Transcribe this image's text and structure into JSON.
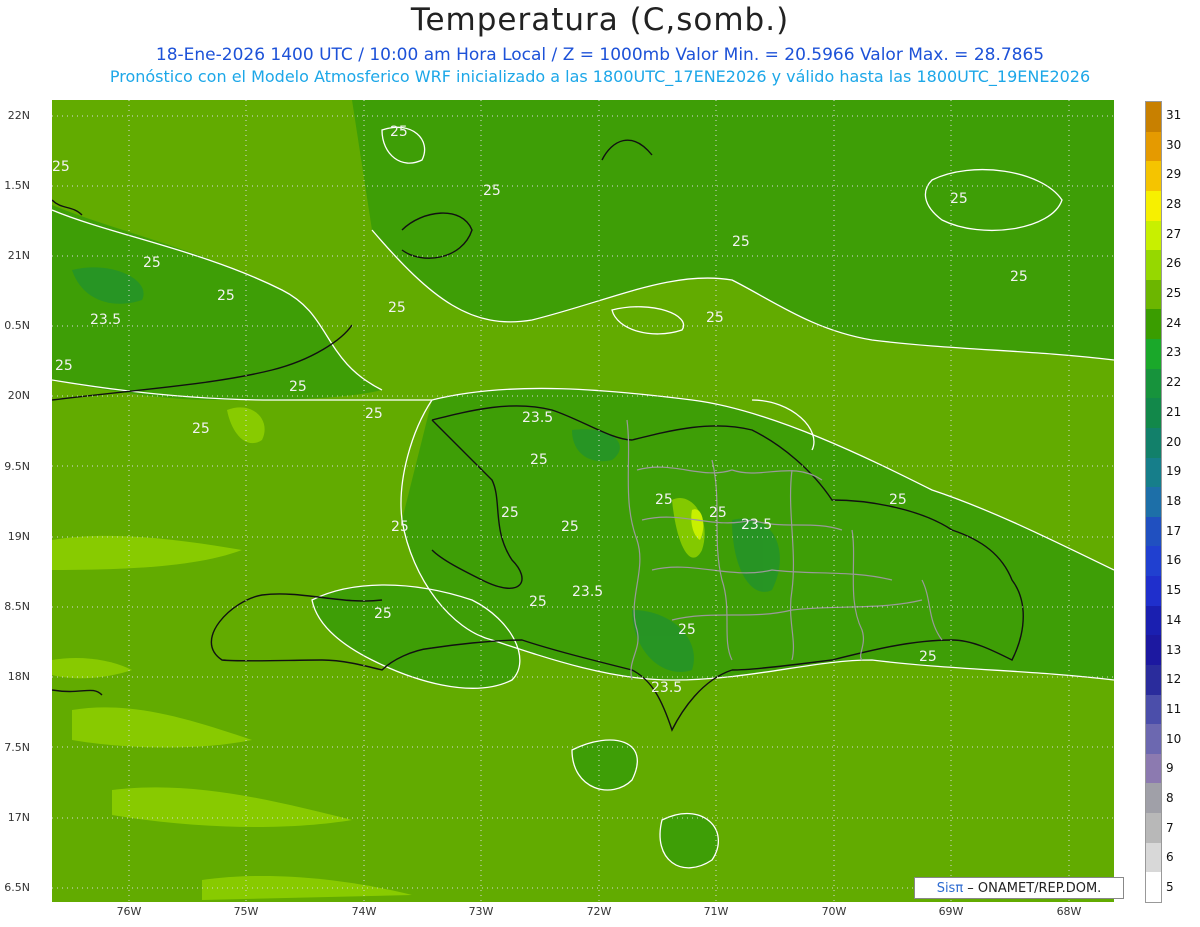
{
  "title": "Temperatura (C,somb.)",
  "subtitle1": "18-Ene-2026 1400 UTC / 10:00 am Hora Local / Z = 1000mb  Valor Min. = 20.5966  Valor Max. = 28.7865",
  "subtitle2": "Pronóstico con el Modelo Atmosferico WRF inicializado a las 1800UTC_17ENE2026 y válido hasta las  1800UTC_19ENE2026",
  "credit": {
    "logo": "Sisπ",
    "text": " – ONAMET/REP.DOM."
  },
  "lat_labels": [
    "22N",
    "1.5N",
    "21N",
    "0.5N",
    "20N",
    "9.5N",
    "19N",
    "8.5N",
    "18N",
    "7.5N",
    "17N",
    "6.5N"
  ],
  "lon_labels": [
    "76W",
    "75W",
    "74W",
    "73W",
    "72W",
    "71W",
    "70W",
    "69W",
    "68W"
  ],
  "contour_labels": [
    "25",
    "25",
    "25",
    "25",
    "25",
    "25",
    "25",
    "25",
    "25",
    "25",
    "25",
    "25",
    "25",
    "25",
    "25",
    "25",
    "25",
    "25",
    "25",
    "25",
    "25",
    "25",
    "25",
    "25",
    "25",
    "23.5",
    "23.5",
    "23.5",
    "23.5",
    "23.5"
  ],
  "colorbar": {
    "labels": [
      "31",
      "30",
      "29",
      "28",
      "27",
      "26",
      "25",
      "24",
      "23",
      "22",
      "21",
      "20",
      "19",
      "18",
      "17",
      "16",
      "15",
      "14",
      "13",
      "12",
      "11",
      "10",
      "9",
      "8",
      "7",
      "6",
      "5"
    ],
    "colors": [
      "#c88000",
      "#e59a00",
      "#f5c400",
      "#f7f000",
      "#c8f000",
      "#96d800",
      "#6cb600",
      "#3a9d00",
      "#1aa82a",
      "#17933c",
      "#12884a",
      "#12806a",
      "#167e8a",
      "#1d6fa8",
      "#2050c0",
      "#2040d0",
      "#1f2fcc",
      "#1a1fb0",
      "#1c18a0",
      "#2a2c9c",
      "#4b4eaa",
      "#6c68b0",
      "#8c7ab0",
      "#a0a0a8",
      "#b8b8b8",
      "#d8d8d8",
      "#ffffff"
    ]
  }
}
